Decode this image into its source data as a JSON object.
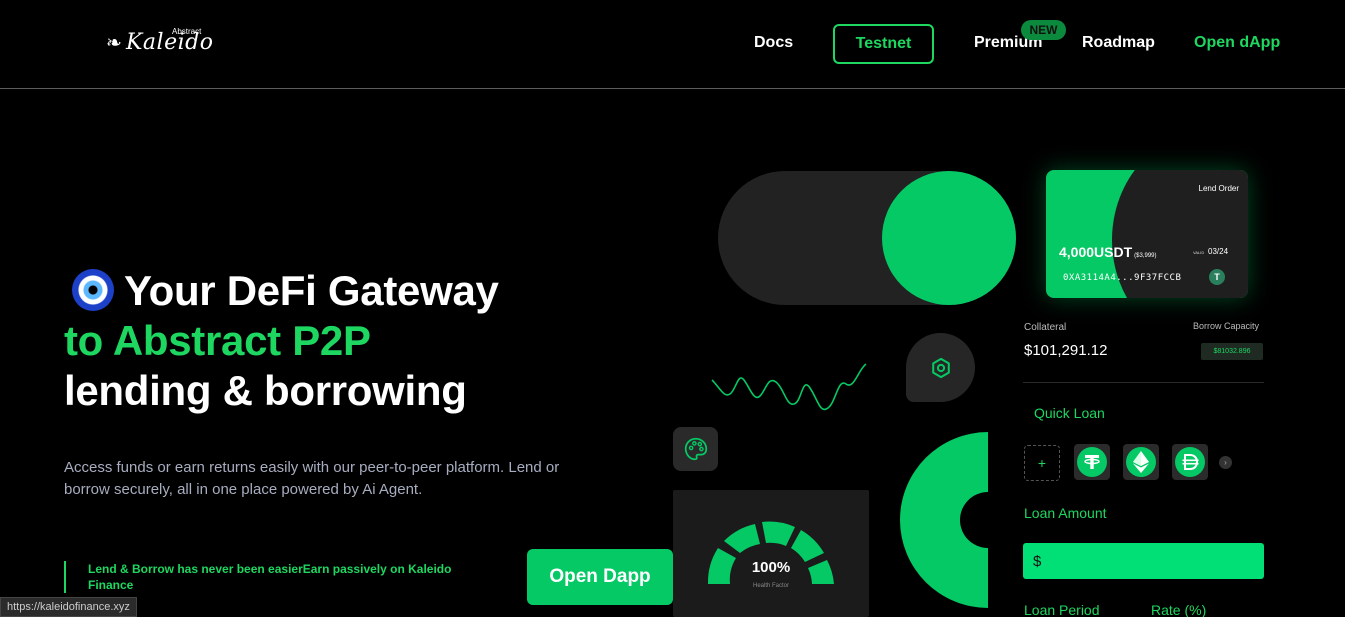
{
  "header": {
    "logo_text": "Kaleido",
    "logo_sup": "Abstract",
    "nav": {
      "docs": "Docs",
      "testnet": "Testnet",
      "premium": "Premium",
      "premium_badge": "NEW",
      "roadmap": "Roadmap",
      "open_dapp": "Open dApp"
    }
  },
  "hero": {
    "line1": "Your DeFi Gateway",
    "line2": "to Abstract P2P",
    "line3": "lending & borrowing",
    "description": "Access funds or earn returns easily with our peer-to-peer platform. Lend or borrow securely, all in one place powered by Ai Agent.",
    "note": "Lend & Borrow has never been easierEarn passively on Kaleido Finance",
    "cta": "Open Dapp"
  },
  "illustration": {
    "gauge_value": "100%",
    "gauge_label": "Health Factor",
    "lend_card": {
      "title": "Lend Order",
      "amount": "4,000USDT",
      "amount_usd": "($3,999)",
      "valid_label": "VALID",
      "valid_date": "03/24",
      "address": "0XA3114A4...9F37FCCB",
      "token_symbol": "T"
    },
    "panel": {
      "collateral_label": "Collateral",
      "collateral_value": "$101,291.12",
      "borrow_capacity_label": "Borrow Capacity",
      "borrow_capacity_value": "$81032.896",
      "quick_loan_label": "Quick Loan",
      "add_symbol": "+",
      "tokens": [
        "USDT",
        "ETH",
        "DAI"
      ],
      "loan_amount_label": "Loan Amount",
      "loan_amount_prefix": "$",
      "loan_period_label": "Loan Period",
      "rate_label": "Rate (%)"
    }
  },
  "status_bar": {
    "url": "https://kaleidofinance.xyz"
  },
  "colors": {
    "accent": "#05c964",
    "accent_text": "#1ed760",
    "background": "#000000",
    "dark_panel": "#222222"
  }
}
